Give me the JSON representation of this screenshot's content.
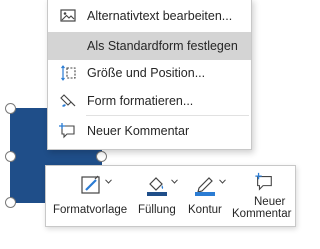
{
  "context_menu": {
    "items": [
      {
        "label": "Alternativtext bearbeiten...",
        "icon": "alt-text-icon"
      },
      {
        "label": "Als Standardform festlegen",
        "icon": "",
        "highlighted": true
      },
      {
        "label": "Größe und Position...",
        "icon": "size-position-icon"
      },
      {
        "label": "Form formatieren...",
        "icon": "format-shape-icon"
      },
      {
        "label": "Neuer Kommentar",
        "icon": "new-comment-icon"
      }
    ]
  },
  "mini_toolbar": {
    "style_label": "Formatvorlage",
    "fill_label": "Füllung",
    "outline_label": "Kontur",
    "comment_label_line1": "Neuer",
    "comment_label_line2": "Kommentar"
  },
  "colors": {
    "shape_fill": "#1f4e89",
    "menu_highlight": "#d4d4d4",
    "accent_blue": "#2b7cd3",
    "fill_swatch": "#1f4e89"
  }
}
